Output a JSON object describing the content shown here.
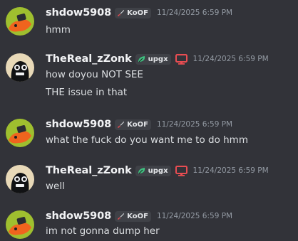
{
  "messages": [
    {
      "username": "shdow5908",
      "tag": "KoOF",
      "timestamp": "11/24/2025 6:59 PM",
      "lines": [
        "hmm"
      ]
    },
    {
      "username": "TheReal_zZonk",
      "tag": "upgx",
      "timestamp": "11/24/2025 6:59 PM",
      "lines": [
        "how doyou NOT SEE",
        "THE issue in that"
      ]
    },
    {
      "username": "shdow5908",
      "tag": "KoOF",
      "timestamp": "11/24/2025 6:59 PM",
      "lines": [
        "what the fuck do you want me to do hmm"
      ]
    },
    {
      "username": "TheReal_zZonk",
      "tag": "upgx",
      "timestamp": "11/24/2025 6:59 PM",
      "lines": [
        "well"
      ]
    },
    {
      "username": "shdow5908",
      "tag": "KoOF",
      "timestamp": "11/24/2025 6:59 PM",
      "lines": [
        "im not gonna dump her"
      ]
    }
  ],
  "icons": {
    "shdow_tag_icon": "sword-icon",
    "zonk_tag_icon": "leaf-icon",
    "zonk_device_icon": "desktop-icon"
  },
  "colors": {
    "background": "#323339",
    "username": "#f2f3f5",
    "message_text": "#dbdee1",
    "timestamp": "#949ba4",
    "tag_background": "#3f4147",
    "desktop_icon": "#e84d52",
    "leaf_icon": "#3fbf7f"
  }
}
